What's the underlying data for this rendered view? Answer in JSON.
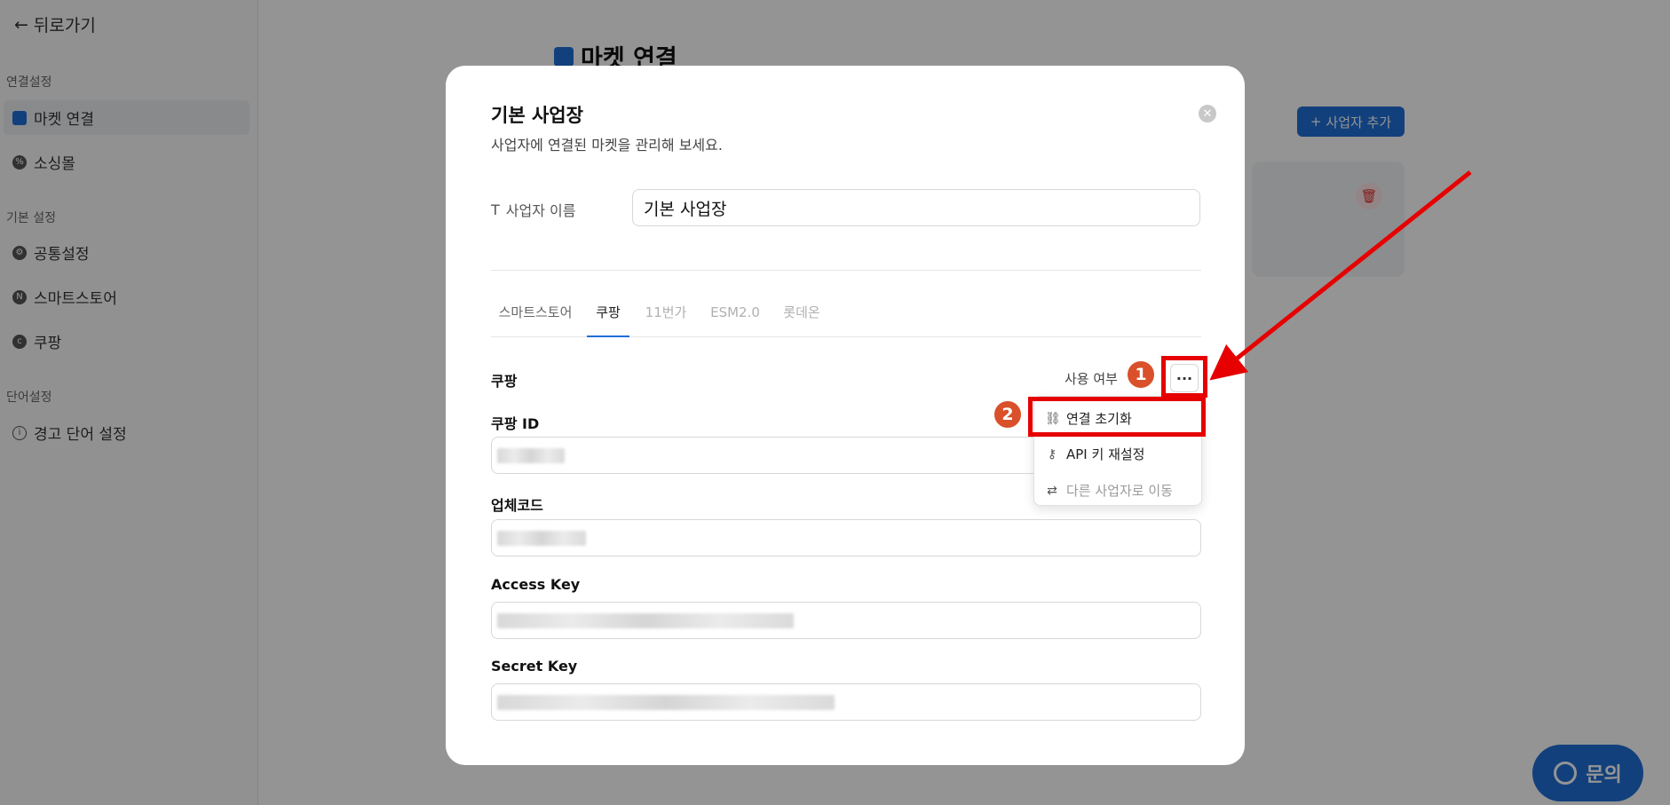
{
  "sidebar": {
    "back_label": "뒤로가기",
    "sections": [
      {
        "title": "연결설정"
      },
      {
        "title": "기본 설정"
      },
      {
        "title": "단어설정"
      }
    ],
    "items": [
      {
        "label": "마켓 연결",
        "icon": "store-icon",
        "active": true
      },
      {
        "label": "소싱몰",
        "icon": "sourcing-icon"
      },
      {
        "label": "공통설정",
        "icon": "gear-icon"
      },
      {
        "label": "스마트스토어",
        "icon": "smartstore-icon"
      },
      {
        "label": "쿠팡",
        "icon": "coupang-icon"
      },
      {
        "label": "경고 단어 설정",
        "icon": "info-icon"
      }
    ]
  },
  "main": {
    "page_title": "마켓 연결",
    "add_button_label": "사업자 추가",
    "help_button_label": "문의"
  },
  "modal": {
    "title": "기본 사업장",
    "subtitle": "사업자에 연결된 마켓을 관리해 보세요.",
    "name_label": "사업자 이름",
    "name_value": "기본 사업장",
    "tabs": [
      {
        "label": "스마트스토어"
      },
      {
        "label": "쿠팡",
        "active": true
      },
      {
        "label": "11번가",
        "disabled": true
      },
      {
        "label": "ESM2.0",
        "disabled": true
      },
      {
        "label": "롯데온",
        "disabled": true
      }
    ],
    "section_title": "쿠팡",
    "use_label": "사용 여부",
    "fields": [
      {
        "label": "쿠팡 ID"
      },
      {
        "label": "업체코드"
      },
      {
        "label": "Access Key"
      },
      {
        "label": "Secret Key"
      }
    ],
    "menu": {
      "items": [
        {
          "label": "연결 초기화"
        },
        {
          "label": "API 키 재설정"
        },
        {
          "label": "다른 사업자로 이동",
          "disabled": true
        }
      ]
    }
  },
  "annotations": {
    "step1": "1",
    "step2": "2",
    "color": "#e60000"
  },
  "colors": {
    "accent": "#1f6fd6",
    "danger": "#e03131"
  }
}
